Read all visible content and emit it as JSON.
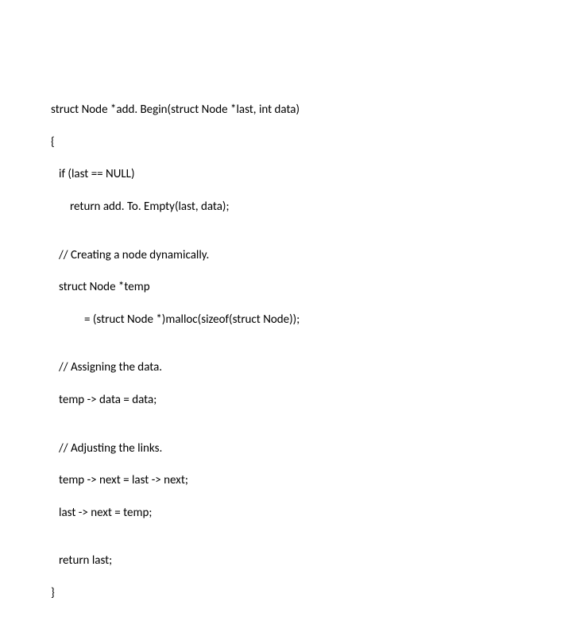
{
  "code": {
    "l1": "struct Node *add. Begin(struct Node *last, int data)",
    "l2": "{",
    "l3": "if (last == NULL)",
    "l4": "return add. To. Empty(last, data);",
    "l5": "",
    "l6": "// Creating a node dynamically.",
    "l7": "struct Node *temp",
    "l8": "= (struct Node *)malloc(sizeof(struct Node));",
    "l9": "",
    "l10": "// Assigning the data.",
    "l11": "temp -> data = data;",
    "l12": "",
    "l13": "// Adjusting the links.",
    "l14": "temp -> next = last -> next;",
    "l15": "last -> next = temp;",
    "l16": "",
    "l17": "return last;",
    "l18": "}"
  }
}
